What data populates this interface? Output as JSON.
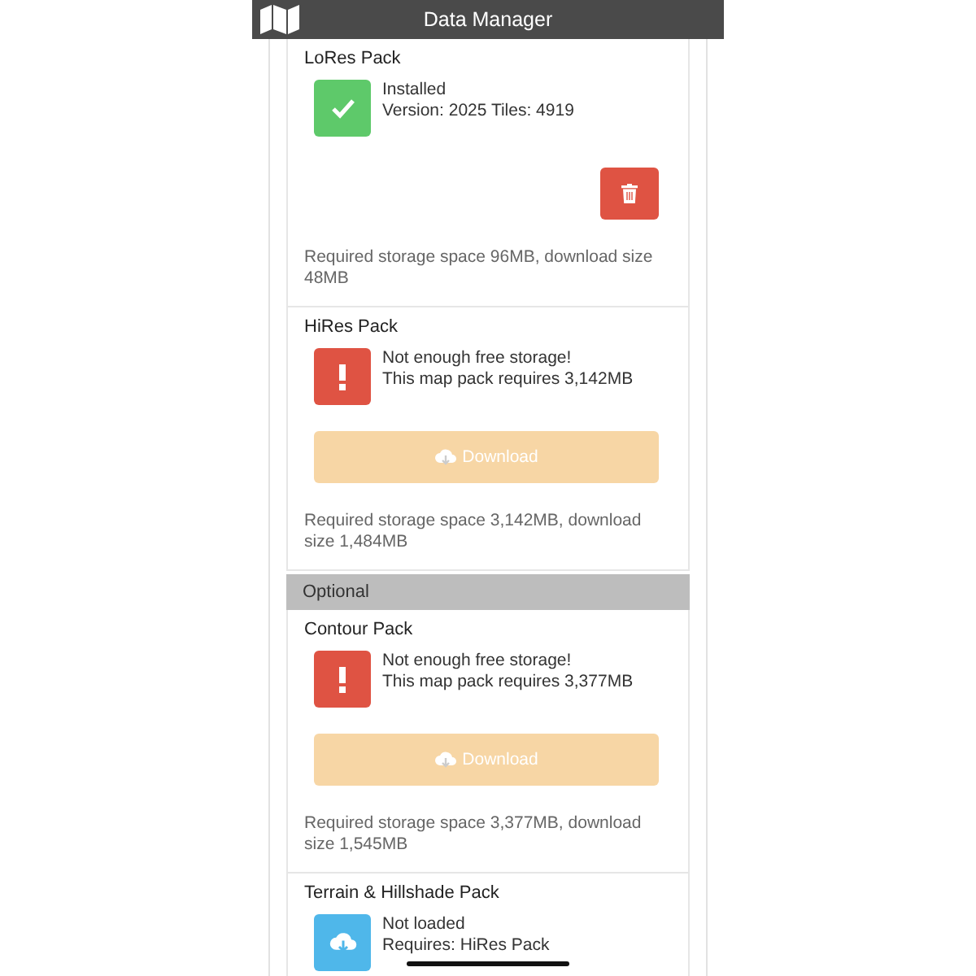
{
  "header": {
    "title": "Data Manager"
  },
  "items": [
    {
      "kind": "pack",
      "title": "LoRes Pack",
      "badge": {
        "kind": "success"
      },
      "status_lines": [
        "Installed",
        "Version: 2025 Tiles: 4919"
      ],
      "action": {
        "kind": "delete"
      },
      "note": "Required storage space 96MB, download size 48MB"
    },
    {
      "kind": "pack",
      "title": "HiRes Pack",
      "badge": {
        "kind": "error"
      },
      "status_lines": [
        "Not enough free storage!",
        "This map pack requires 3,142MB"
      ],
      "action": {
        "kind": "download",
        "label": "Download",
        "disabled": true
      },
      "note": "Required storage space 3,142MB, download size 1,484MB"
    },
    {
      "kind": "section",
      "title": "Optional"
    },
    {
      "kind": "pack",
      "title": "Contour Pack",
      "badge": {
        "kind": "error"
      },
      "status_lines": [
        "Not enough free storage!",
        "This map pack requires 3,377MB"
      ],
      "action": {
        "kind": "download",
        "label": "Download",
        "disabled": true
      },
      "note": "Required storage space 3,377MB, download size 1,545MB"
    },
    {
      "kind": "pack",
      "title": "Terrain & Hillshade Pack",
      "badge": {
        "kind": "cloud"
      },
      "status_lines": [
        "Not loaded",
        "Requires: HiRes Pack"
      ]
    }
  ]
}
